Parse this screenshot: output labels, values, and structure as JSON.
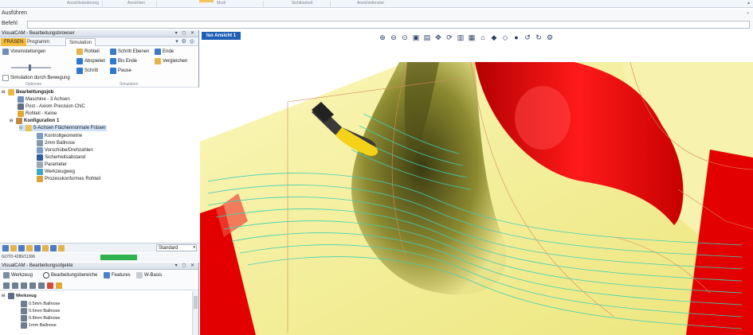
{
  "ribbon": {
    "groups": [
      "Ansichtsänderung",
      "Ansichten",
      "Modi",
      "Sichtbarkeit",
      "Ansichtsfenster"
    ]
  },
  "command": {
    "ausfuehren_label": "Ausführen",
    "befehl_label": "Befehl",
    "befehl_value": ""
  },
  "browser": {
    "title": "VisualCAM - Bearbeitungsbrowser",
    "controls": "▾ ◻ ✕",
    "tabs": [
      "FRÄSEN",
      "Programm",
      "Simulation"
    ],
    "buttons": {
      "voreinstellungen": "Voreinstellungen",
      "sim_bewegung": "Simulation durch Bewegung",
      "rohteil": "Rohteil",
      "schritt_ebenen": "Schritt Ebenen",
      "ende": "Ende",
      "abspielen": "Abspielen",
      "bis_ende": "Bis Ende",
      "vergleichen": "Vergleichen",
      "schritt": "Schritt",
      "pause": "Pause"
    },
    "captions": {
      "optionen": "Optionen",
      "simulation": "Simulation"
    },
    "tree": [
      "Bearbeitungsjob",
      "Maschine - 3 Achsen",
      "Post - Axiom Precision CNC",
      "Rohteil - Keine",
      "Konfiguration 1",
      "5-Achsen Flächennormale Fräsen",
      "Kontrollgeometrie",
      "2mm Ballnose",
      "Vorschübe/Drehzahlen",
      "Sicherheitsabstand",
      "Parameter",
      "Werkzeugweg",
      "Prozesskonformes Rohteil"
    ],
    "combo_value": "Standard",
    "status_text": "GOTO 4280/11306",
    "progress": 0.38
  },
  "objects": {
    "title": "VisualCAM - Bearbeitungsobjekte",
    "controls": "▾ ◻ ✕",
    "buttons": {
      "werkzeug": "Werkzeug",
      "bearbeitungsbereiche": "Bearbeitungsbereiche",
      "features": "Features",
      "wbasis": "W-Basis"
    },
    "tree": [
      "Werkzeug",
      "0.5mm Ballnose",
      "0.6mm Ballnose",
      "0.8mm Ballnose",
      "1mm Ballnose"
    ]
  },
  "viewport": {
    "tab_label": "Iso Ansicht 1",
    "toolbar_icons": [
      "zoom-in-icon",
      "zoom-out-icon",
      "zoom-window-icon",
      "zoom-extents-icon",
      "zoom-target-icon",
      "pan-icon",
      "rotate-icon",
      "view-top-icon",
      "view-front-icon",
      "home-icon",
      "shaded-icon",
      "wireframe-icon",
      "cube-icon",
      "rotate-left-icon",
      "rotate-right-icon",
      "settings-icon"
    ]
  },
  "colors": {
    "part_red": "#e30000",
    "part_yellow": "#f6f19a",
    "toolpath": "#3fd0b6",
    "tool_yellow": "#f5d21a",
    "selection_blue": "#1f5fb5"
  }
}
